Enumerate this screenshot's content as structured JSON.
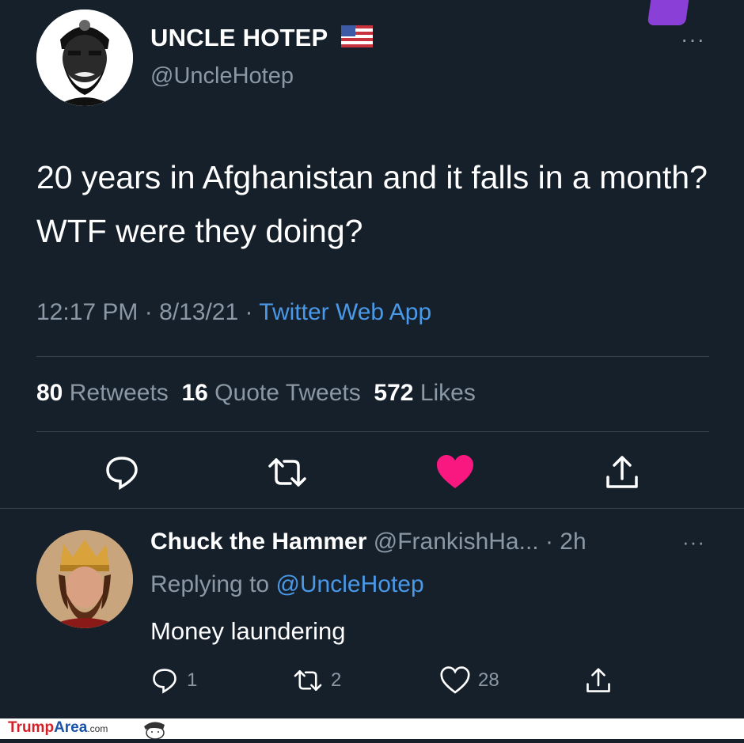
{
  "tweet": {
    "display_name": "UNCLE HOTEP",
    "flag": "🇺🇸",
    "handle": "@UncleHotep",
    "text": "20 years in Afghanistan and it falls in a month? WTF were they doing?",
    "time": "12:17 PM · 8/13/21 · ",
    "source": "Twitter Web App",
    "stats": {
      "retweets_count": "80",
      "retweets_label": "Retweets",
      "quotes_count": "16",
      "quotes_label": "Quote Tweets",
      "likes_count": "572",
      "likes_label": "Likes"
    },
    "more": "···",
    "icons": [
      "reply-icon",
      "retweet-icon",
      "like-icon-filled",
      "share-icon"
    ],
    "like_color": "#f91880"
  },
  "reply": {
    "display_name": "Chuck the Hammer",
    "handle_time": "@FrankishHa... · 2h",
    "more": "···",
    "replying_prefix": "Replying to ",
    "replying_to": "@UncleHotep",
    "text": "Money laundering",
    "reply_count": "1",
    "retweet_count": "2",
    "like_count": "28"
  },
  "footer": {
    "brand_a": "Trump",
    "brand_b": "Area",
    "brand_c": ".com"
  },
  "colors": {
    "background": "#15202b",
    "accent": "#4a99e9",
    "secondary_text": "#8b98a5"
  }
}
